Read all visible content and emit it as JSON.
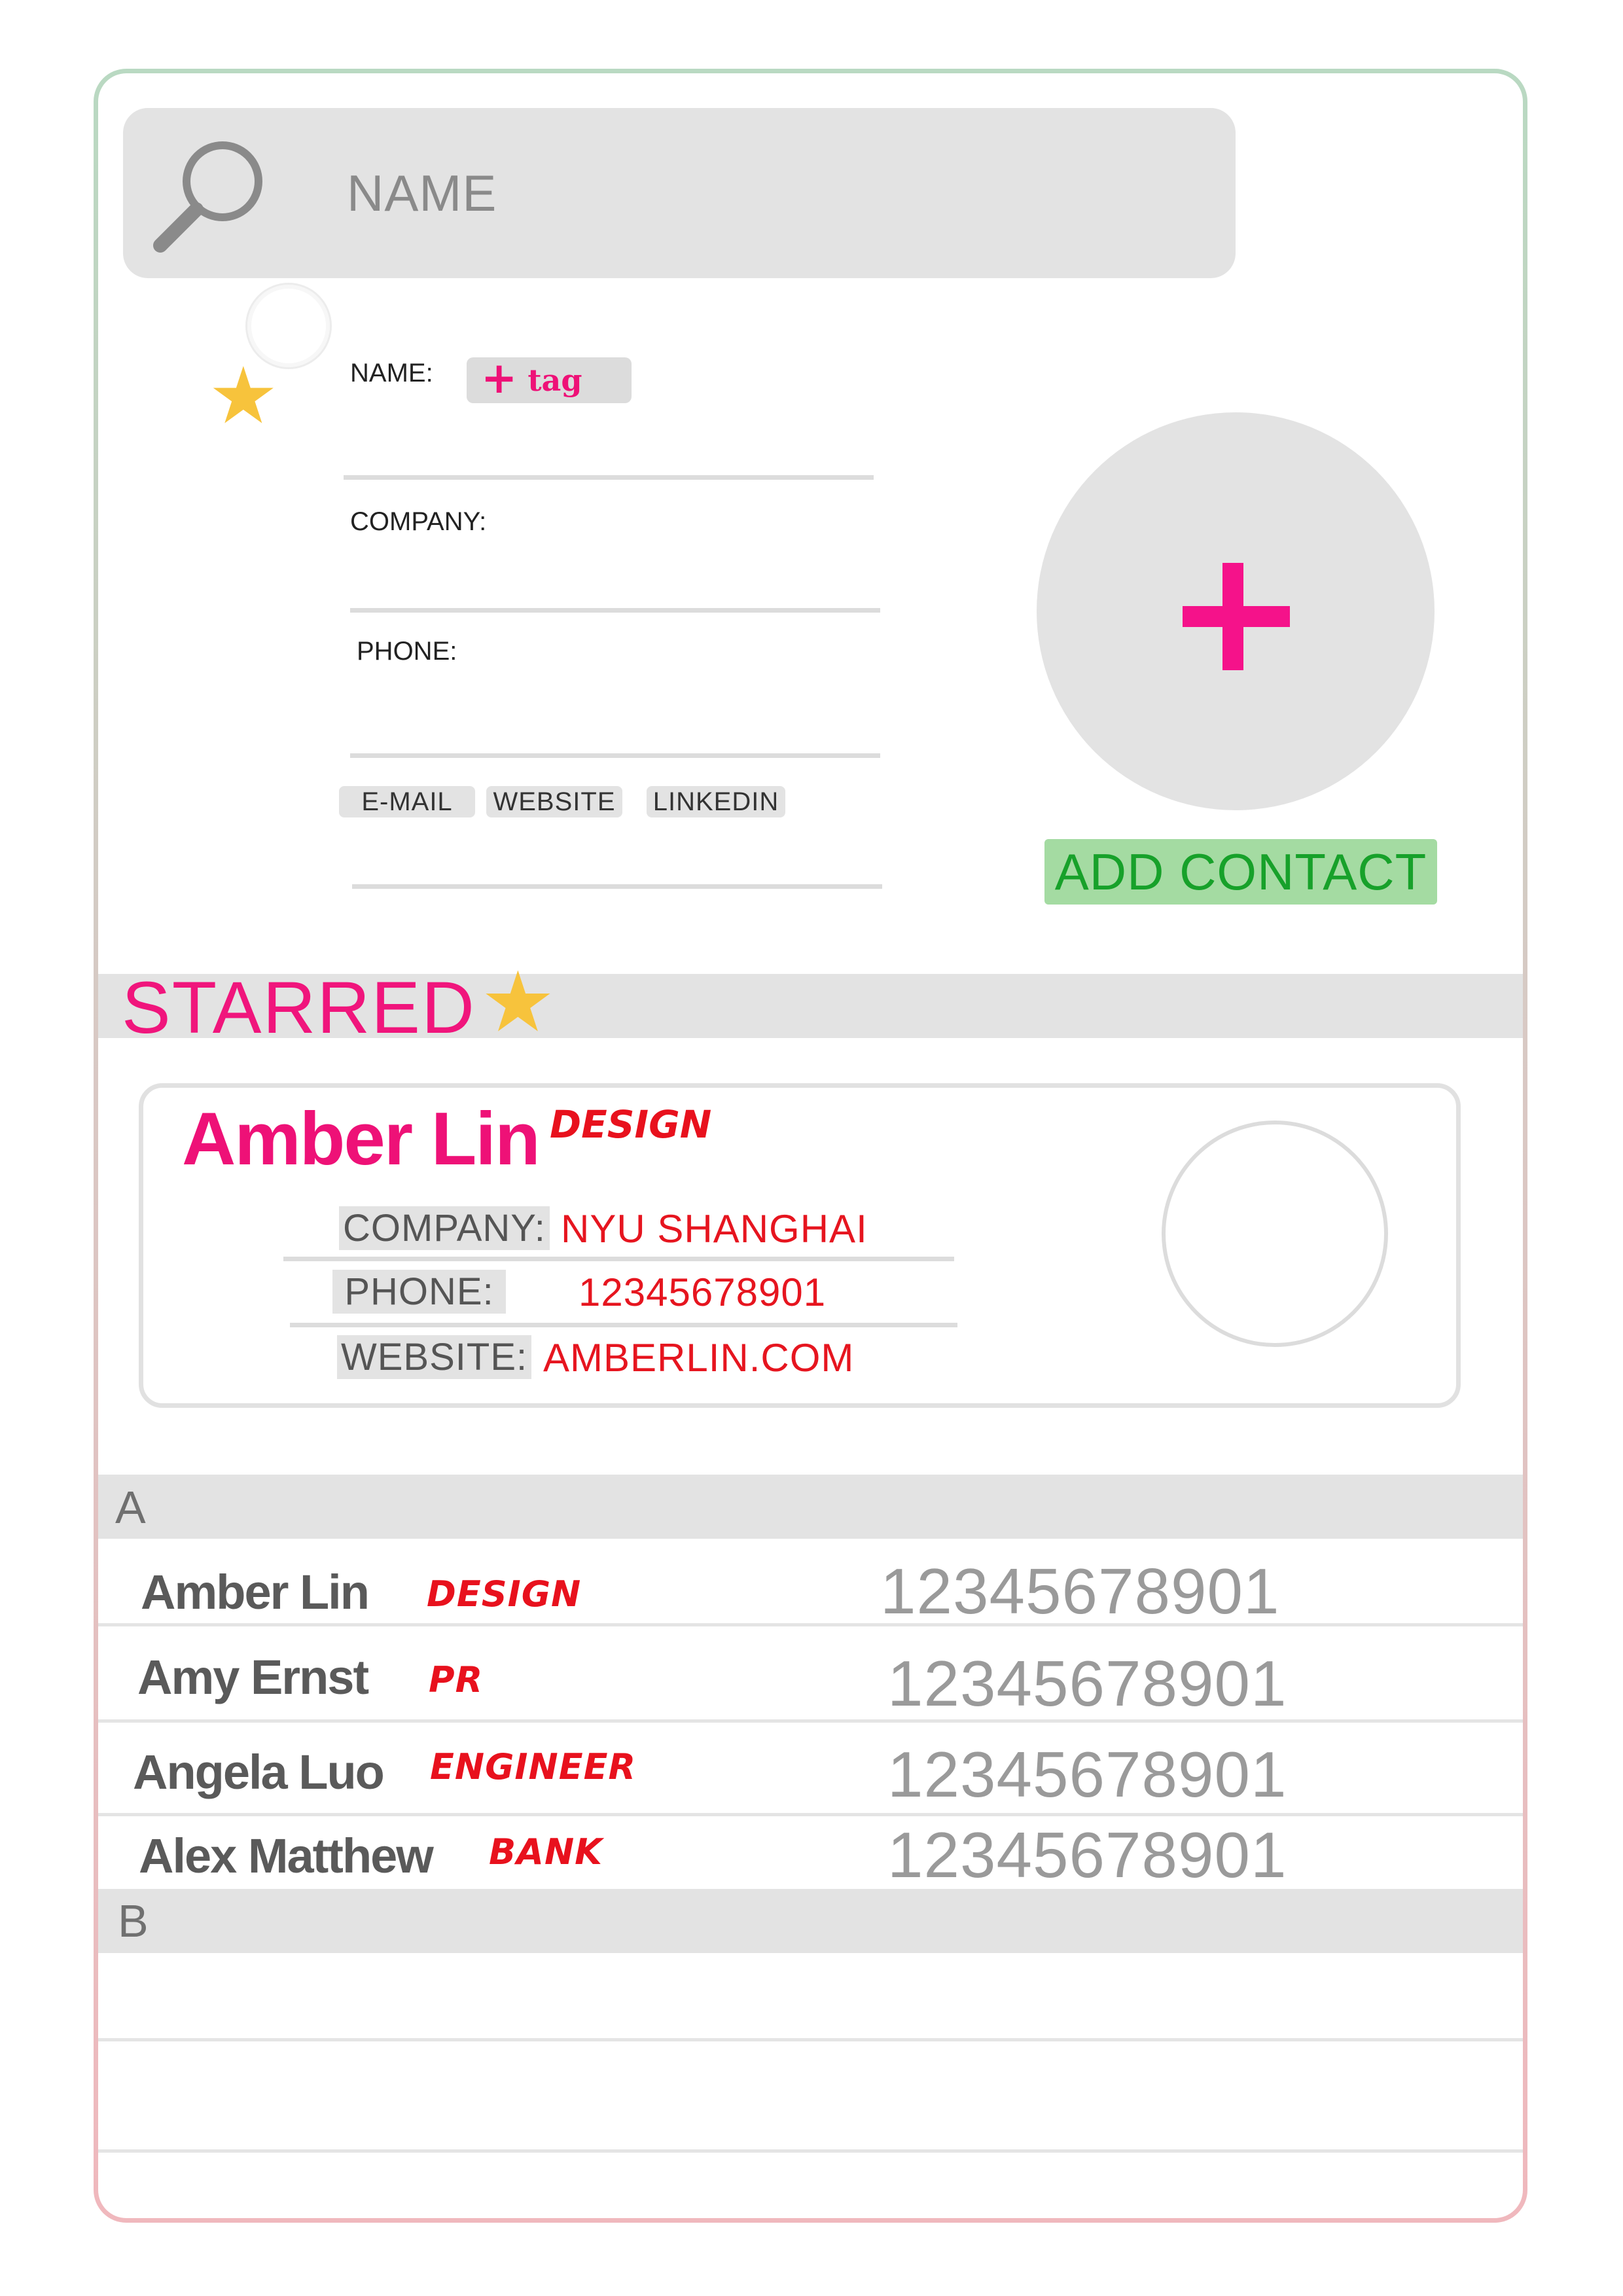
{
  "search": {
    "placeholder": "NAME"
  },
  "form": {
    "name_label": "NAME:",
    "tag_button": "tag",
    "company_label": "COMPANY:",
    "phone_label": "PHONE:",
    "chips": [
      "E-MAIL",
      "WEBSITE",
      "LINKEDIN"
    ],
    "add_contact": "ADD CONTACT"
  },
  "starred": {
    "title": "STARRED",
    "card": {
      "name": "Amber Lin",
      "tag": "DESIGN",
      "company_label": "COMPANY:",
      "company": "NYU SHANGHAI",
      "phone_label": "PHONE:",
      "phone": "12345678901",
      "website_label": "WEBSITE:",
      "website": "AMBERLIN.COM"
    }
  },
  "sections": [
    {
      "letter": "A",
      "contacts": [
        {
          "name": "Amber Lin",
          "tag": "DESIGN",
          "phone": "12345678901"
        },
        {
          "name": "Amy Ernst",
          "tag": "PR",
          "phone": "12345678901"
        },
        {
          "name": "Angela Luo",
          "tag": "ENGINEER",
          "phone": "12345678901"
        },
        {
          "name": "Alex Matthew",
          "tag": "BANK",
          "phone": "12345678901"
        }
      ]
    },
    {
      "letter": "B",
      "contacts": []
    }
  ],
  "colors": {
    "accent_pink": "#f0157c",
    "tag_red": "#e8111d",
    "star_yellow": "#f7c33c",
    "add_green": "#17a12a",
    "panel_grey": "#e3e3e3"
  },
  "icons": [
    "search-icon",
    "star-icon",
    "plus-icon",
    "avatar-placeholder-icon"
  ]
}
